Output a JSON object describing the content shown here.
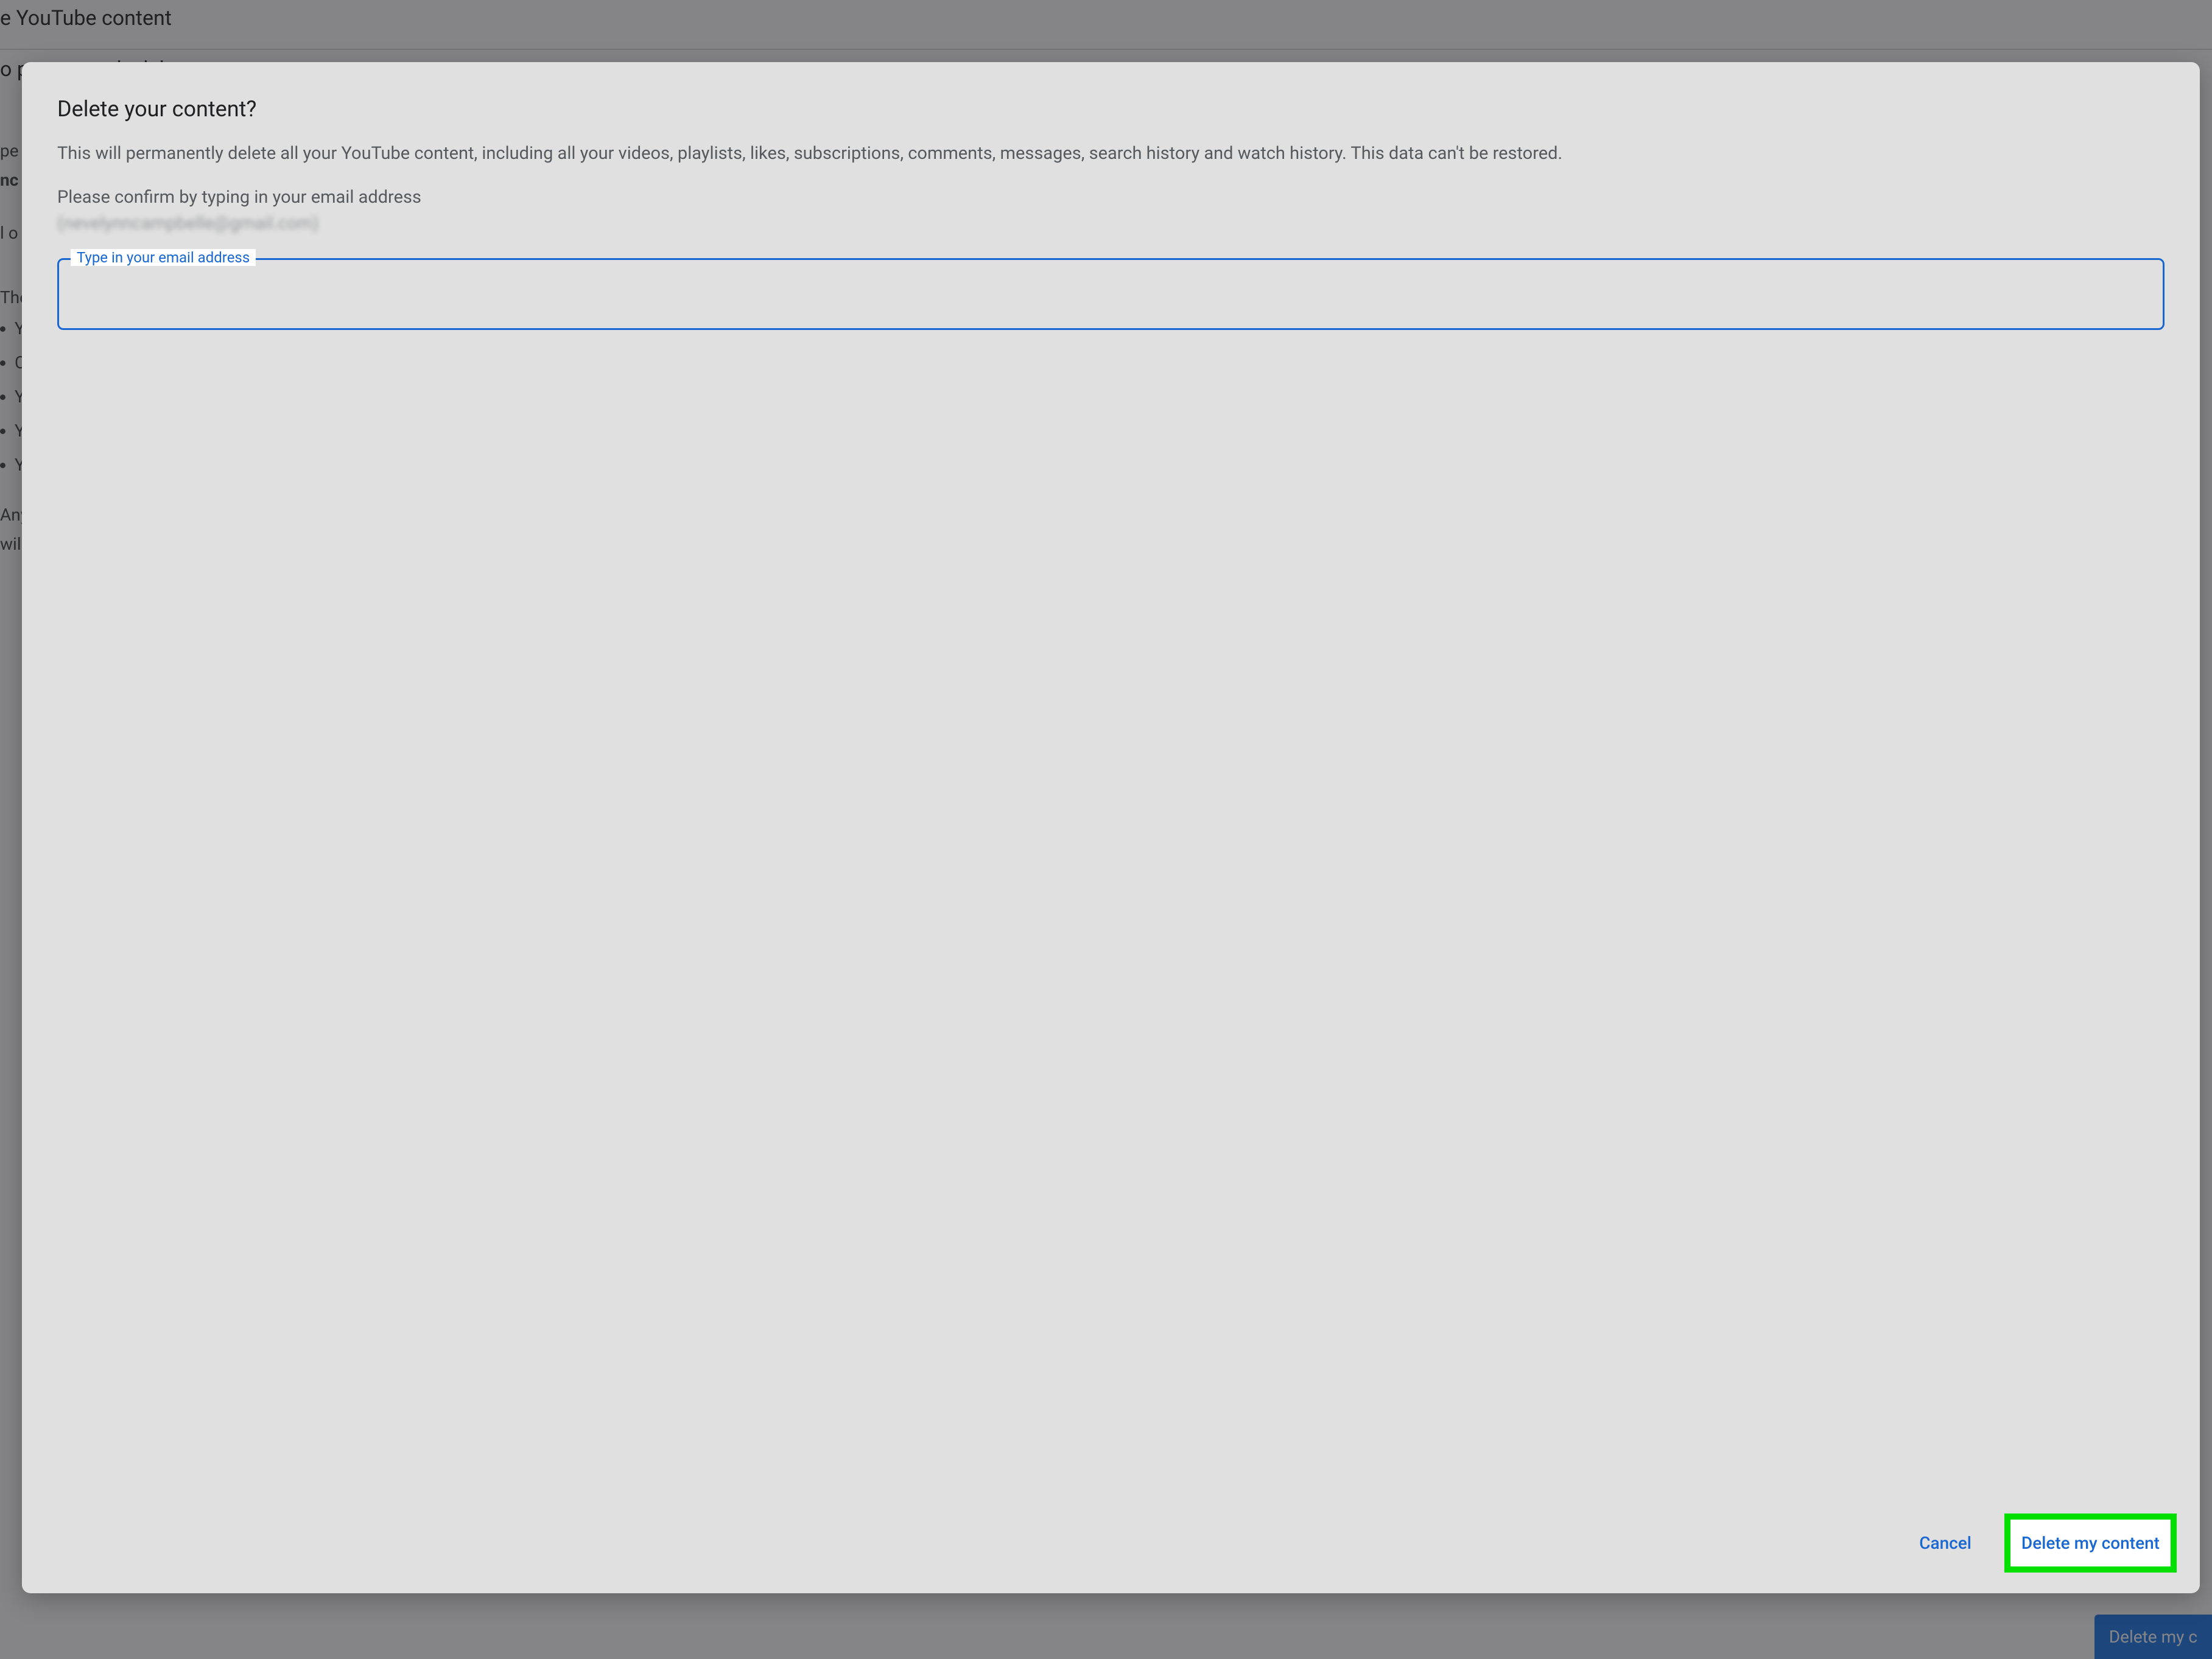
{
  "background": {
    "heading1": "e YouTube content",
    "heading2": "o permanently delete my content",
    "line1a": "pe",
    "line1b": "nc",
    "line2": "l o",
    "line3": "The",
    "bullets": [
      "Y",
      "C",
      "Y",
      "Y",
      "Y"
    ],
    "footer1": "Any",
    "footer2": "will",
    "button": "Delete my c"
  },
  "modal": {
    "title": "Delete your content?",
    "description": "This will permanently delete all your YouTube content, including all your videos, playlists, likes, subscriptions, comments, messages, search history and watch history. This data can't be restored.",
    "confirm_prompt": "Please confirm by typing in your email address",
    "redacted_email": "(nevelynncampbelle@gmail.com)",
    "field_label": "Type in your email address",
    "field_value": "",
    "cancel_label": "Cancel",
    "delete_label": "Delete my content"
  }
}
